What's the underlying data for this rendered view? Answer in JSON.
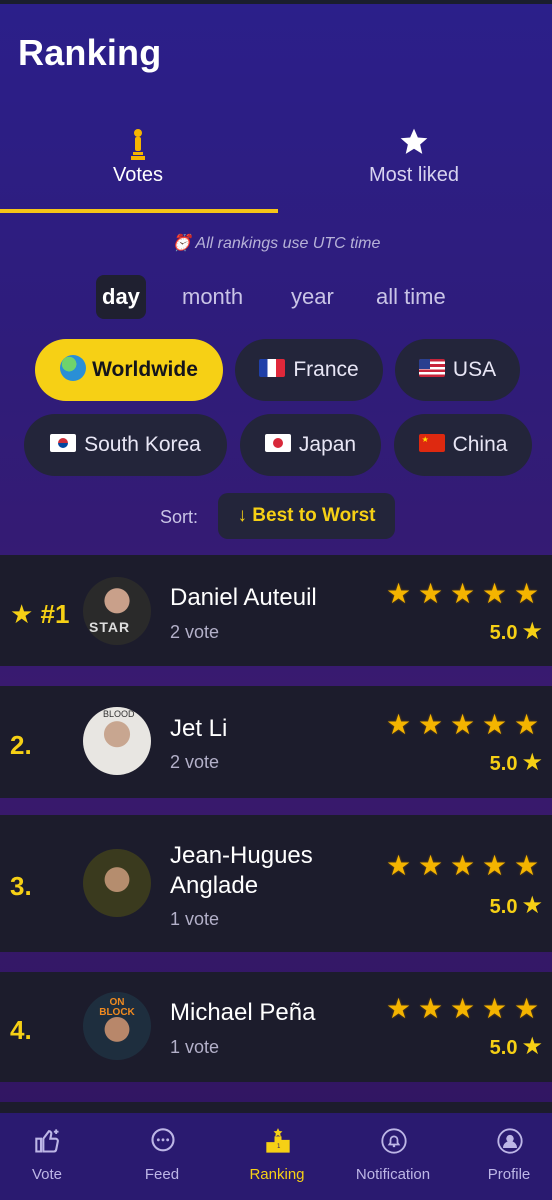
{
  "title": "Ranking",
  "tabs": [
    {
      "label": "Votes",
      "icon": "oscar-trophy-icon",
      "active": true
    },
    {
      "label": "Most liked",
      "icon": "star-icon",
      "active": false
    }
  ],
  "utc_note": "⏰ All rankings use UTC time",
  "periods": [
    {
      "label": "day",
      "active": true
    },
    {
      "label": "month",
      "active": false
    },
    {
      "label": "year",
      "active": false
    },
    {
      "label": "all time",
      "active": false
    }
  ],
  "regions": [
    {
      "label": "Worldwide",
      "icon": "globe-icon",
      "active": true
    },
    {
      "label": "France",
      "icon": "flag-france-icon",
      "active": false
    },
    {
      "label": "USA",
      "icon": "flag-usa-icon",
      "active": false
    },
    {
      "label": "South Korea",
      "icon": "flag-south-korea-icon",
      "active": false
    },
    {
      "label": "Japan",
      "icon": "flag-japan-icon",
      "active": false
    },
    {
      "label": "China",
      "icon": "flag-china-icon",
      "active": false
    }
  ],
  "sort": {
    "label": "Sort:",
    "value": "↓ Best to Worst"
  },
  "rankings": [
    {
      "rank": "★ #1",
      "name": "Daniel Auteuil",
      "votes": "2 vote",
      "rating": 5,
      "score": "5.0"
    },
    {
      "rank": "2.",
      "name": "Jet Li",
      "votes": "2 vote",
      "rating": 5,
      "score": "5.0"
    },
    {
      "rank": "3.",
      "name": "Jean-Hugues Anglade",
      "name_line1": "Jean-Hugues",
      "name_line2": "Anglade",
      "votes": "1 vote",
      "rating": 5,
      "score": "5.0"
    },
    {
      "rank": "4.",
      "name": "Michael Peña",
      "votes": "1 vote",
      "rating": 5,
      "score": "5.0"
    }
  ],
  "avatar_text": {
    "card1": "STAR",
    "card2": "BLOOD",
    "card4": "ON BLOCK"
  },
  "nav": [
    {
      "label": "Vote",
      "icon": "thumbs-up-icon",
      "active": false
    },
    {
      "label": "Feed",
      "icon": "chat-bubble-icon",
      "active": false
    },
    {
      "label": "Ranking",
      "icon": "podium-icon",
      "active": true
    },
    {
      "label": "Notification",
      "icon": "bell-icon",
      "active": false
    },
    {
      "label": "Profile",
      "icon": "profile-icon",
      "active": false
    }
  ],
  "colors": {
    "accent": "#f6d015",
    "card_bg": "#1c1c2c",
    "chip_bg": "#23253a",
    "nav_bg": "#2a1a70"
  }
}
